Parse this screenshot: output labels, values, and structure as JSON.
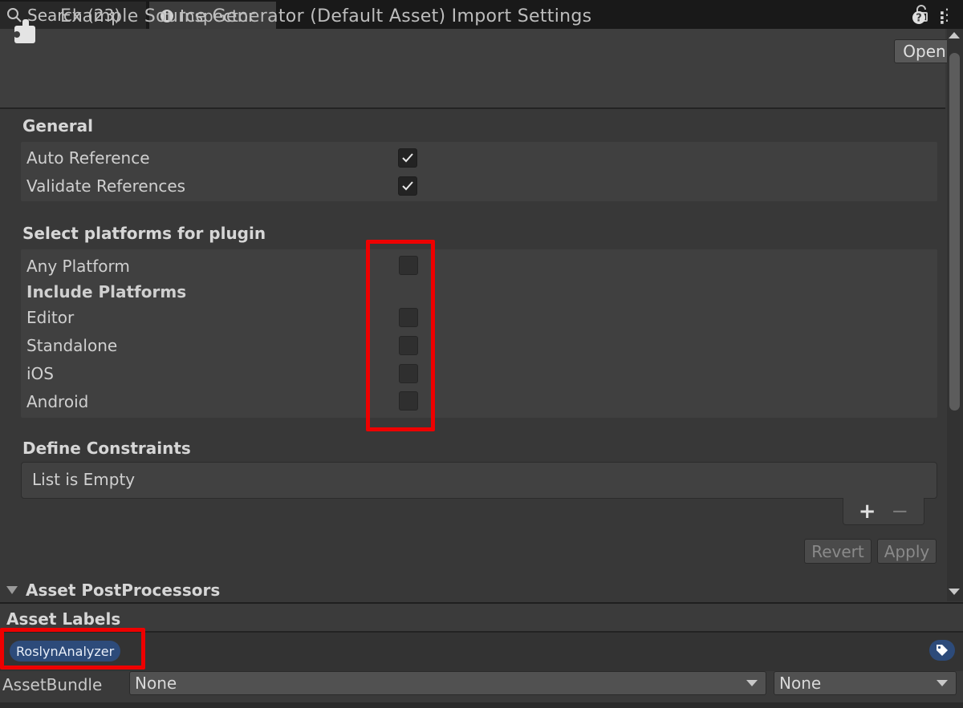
{
  "tabs": [
    {
      "label": "Search (23)",
      "icon": "search-icon"
    },
    {
      "label": "Inspector",
      "icon": "info-icon"
    }
  ],
  "header": {
    "title": "Example Source Generator (Default Asset) Import Settings",
    "open_label": "Open",
    "help_glyph": "?",
    "menu_glyph": "⋮"
  },
  "general": {
    "title": "General",
    "rows": [
      {
        "label": "Auto Reference",
        "checked": true
      },
      {
        "label": "Validate References",
        "checked": true
      }
    ]
  },
  "platforms": {
    "title": "Select platforms for plugin",
    "any_platform": {
      "label": "Any Platform",
      "checked": false
    },
    "include_title": "Include Platforms",
    "rows": [
      {
        "label": "Editor",
        "checked": false
      },
      {
        "label": "Standalone",
        "checked": false
      },
      {
        "label": "iOS",
        "checked": false
      },
      {
        "label": "Android",
        "checked": false
      }
    ]
  },
  "define_constraints": {
    "title": "Define Constraints",
    "empty_text": "List is Empty",
    "add_glyph": "+",
    "remove_glyph": "−"
  },
  "actions": {
    "revert_label": "Revert",
    "apply_label": "Apply"
  },
  "post_processors": {
    "title": "Asset PostProcessors"
  },
  "asset_labels": {
    "title": "Asset Labels",
    "labels": [
      "RoslynAnalyzer"
    ]
  },
  "asset_bundle": {
    "label": "AssetBundle",
    "name_value": "None",
    "variant_value": "None"
  },
  "colors": {
    "highlight": "#ee0000",
    "label_chip": "#2d4b7a"
  }
}
